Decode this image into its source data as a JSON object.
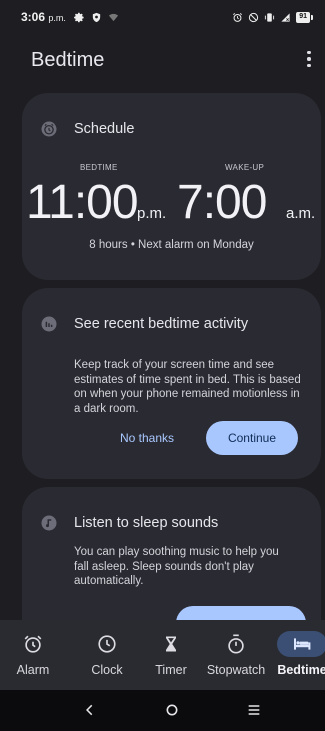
{
  "status_bar": {
    "time": "3:06",
    "ampm": "p.m.",
    "battery": "91",
    "left_icons": [
      "gear-icon",
      "shield-icon",
      "wifi-icon"
    ],
    "right_icons": [
      "alarm-icon",
      "do-not-disturb-icon",
      "vibrate-icon",
      "signal-icon",
      "battery-icon"
    ]
  },
  "app_bar": {
    "title": "Bedtime",
    "menu_icon": "more-vert-icon"
  },
  "schedule_card": {
    "title": "Schedule",
    "icon": "alarm-clock-icon",
    "bedtime_label": "BEDTIME",
    "wakeup_label": "WAKE-UP",
    "bedtime_time": "11:00",
    "bedtime_ampm": "p.m.",
    "wakeup_time": "7:00",
    "wakeup_ampm": "a.m.",
    "summary": "8 hours • Next alarm on Monday"
  },
  "activity_card": {
    "title": "See recent bedtime activity",
    "icon": "bar-chart-icon",
    "description": "Keep track of your screen time and see estimates of time spent in bed. This is based on when your phone remained motionless in a dark room.",
    "dismiss_label": "No thanks",
    "continue_label": "Continue"
  },
  "sounds_card": {
    "title": "Listen to sleep sounds",
    "icon": "music-note-icon",
    "description": "You can play soothing music to help you fall asleep. Sleep sounds don't play automatically."
  },
  "bottom_nav": {
    "items": [
      {
        "label": "Alarm",
        "icon": "alarm-icon"
      },
      {
        "label": "Clock",
        "icon": "clock-icon"
      },
      {
        "label": "Timer",
        "icon": "hourglass-icon"
      },
      {
        "label": "Stopwatch",
        "icon": "stopwatch-icon"
      },
      {
        "label": "Bedtime",
        "icon": "bed-icon",
        "active": true
      }
    ]
  },
  "system_nav": [
    "back-icon",
    "home-icon",
    "recents-icon"
  ],
  "colors": {
    "background": "#1d1d22",
    "card": "#2a2b32",
    "accent": "#a9c7ff",
    "active_pill": "#3b4f74"
  }
}
